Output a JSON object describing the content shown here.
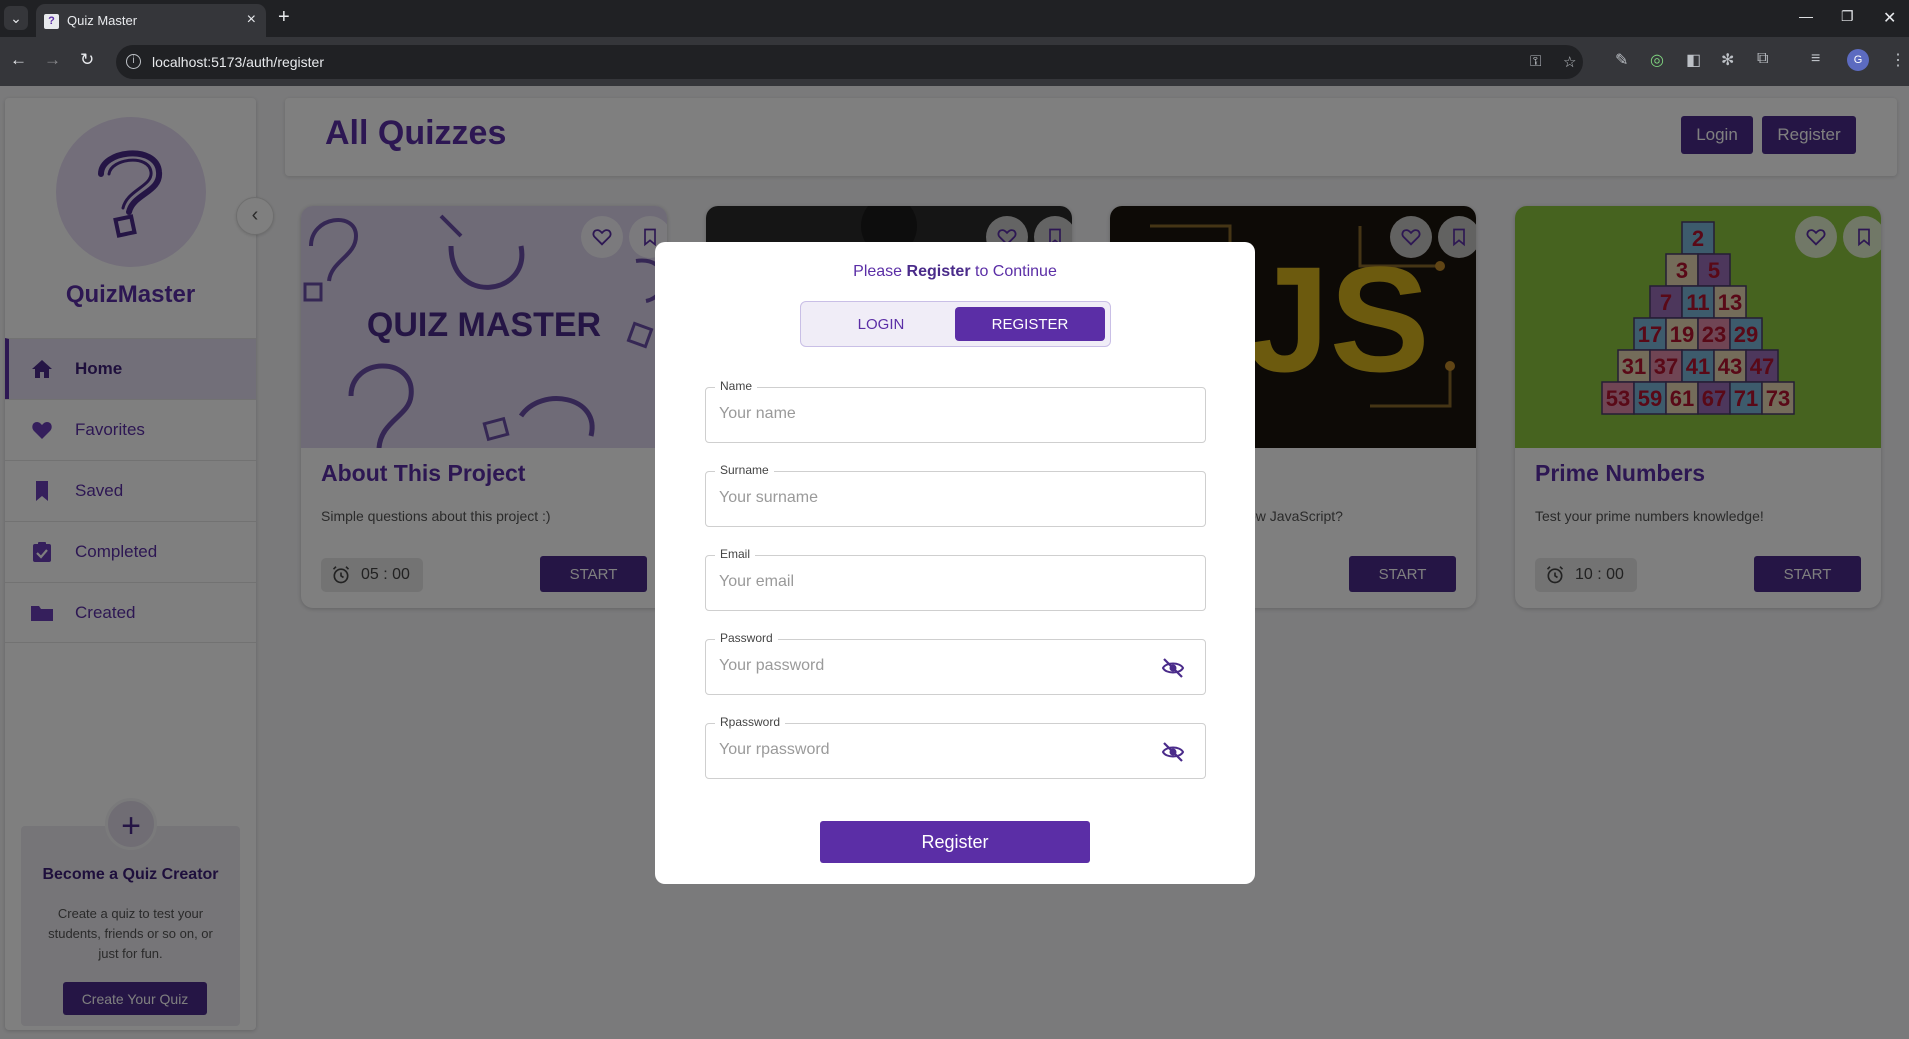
{
  "browser": {
    "tab_title": "Quiz Master",
    "url": "localhost:5173/auth/register",
    "profile_initial": "G"
  },
  "sidebar": {
    "brand": "QuizMaster",
    "items": [
      {
        "label": "Home",
        "icon": "home-icon",
        "active": true
      },
      {
        "label": "Favorites",
        "icon": "heart-icon",
        "active": false
      },
      {
        "label": "Saved",
        "icon": "bookmark-icon",
        "active": false
      },
      {
        "label": "Completed",
        "icon": "clipboard-check-icon",
        "active": false
      },
      {
        "label": "Created",
        "icon": "folder-icon",
        "active": false
      }
    ],
    "creator": {
      "title": "Become a Quiz Creator",
      "description": "Create a quiz to test your students, friends or so on, or just for fun.",
      "button": "Create Your Quiz"
    }
  },
  "header": {
    "title": "All Quizzes",
    "login": "Login",
    "register": "Register"
  },
  "quizzes": [
    {
      "title": "About This Project",
      "description": "Simple questions about this project :)",
      "timer": "05 : 00",
      "start": "START",
      "image": "quiz-master-doodle"
    },
    {
      "title": "",
      "description": "",
      "timer": "",
      "start": "",
      "image": "person-photo"
    },
    {
      "title": "",
      "description": "ow JavaScript?",
      "timer": "",
      "start": "START",
      "image": "js-circuit"
    },
    {
      "title": "Prime Numbers",
      "description": "Test your prime numbers knowledge!",
      "timer": "10 : 00",
      "start": "START",
      "image": "prime-pyramid",
      "pyramid_rows": [
        [
          "2"
        ],
        [
          "3",
          "5"
        ],
        [
          "7",
          "11",
          "13"
        ],
        [
          "17",
          "19",
          "23",
          "29"
        ],
        [
          "31",
          "37",
          "41",
          "43",
          "47"
        ],
        [
          "53",
          "59",
          "61",
          "67",
          "71",
          "73"
        ]
      ]
    }
  ],
  "modal": {
    "heading_prefix": "Please ",
    "heading_bold": "Register",
    "heading_suffix": " to Continue",
    "tab_login": "LOGIN",
    "tab_register": "REGISTER",
    "active_tab": "register",
    "fields": [
      {
        "label": "Name",
        "placeholder": "Your name",
        "value": ""
      },
      {
        "label": "Surname",
        "placeholder": "Your surname",
        "value": ""
      },
      {
        "label": "Email",
        "placeholder": "Your email",
        "value": ""
      },
      {
        "label": "Password",
        "placeholder": "Your password",
        "value": ""
      },
      {
        "label": "Rpassword",
        "placeholder": "Your rpassword",
        "value": ""
      }
    ],
    "submit": "Register"
  },
  "colors": {
    "accent": "#5b2ea6",
    "accent_dark": "#4a2b8a",
    "overlay": "rgba(0,0,0,0.5)"
  }
}
